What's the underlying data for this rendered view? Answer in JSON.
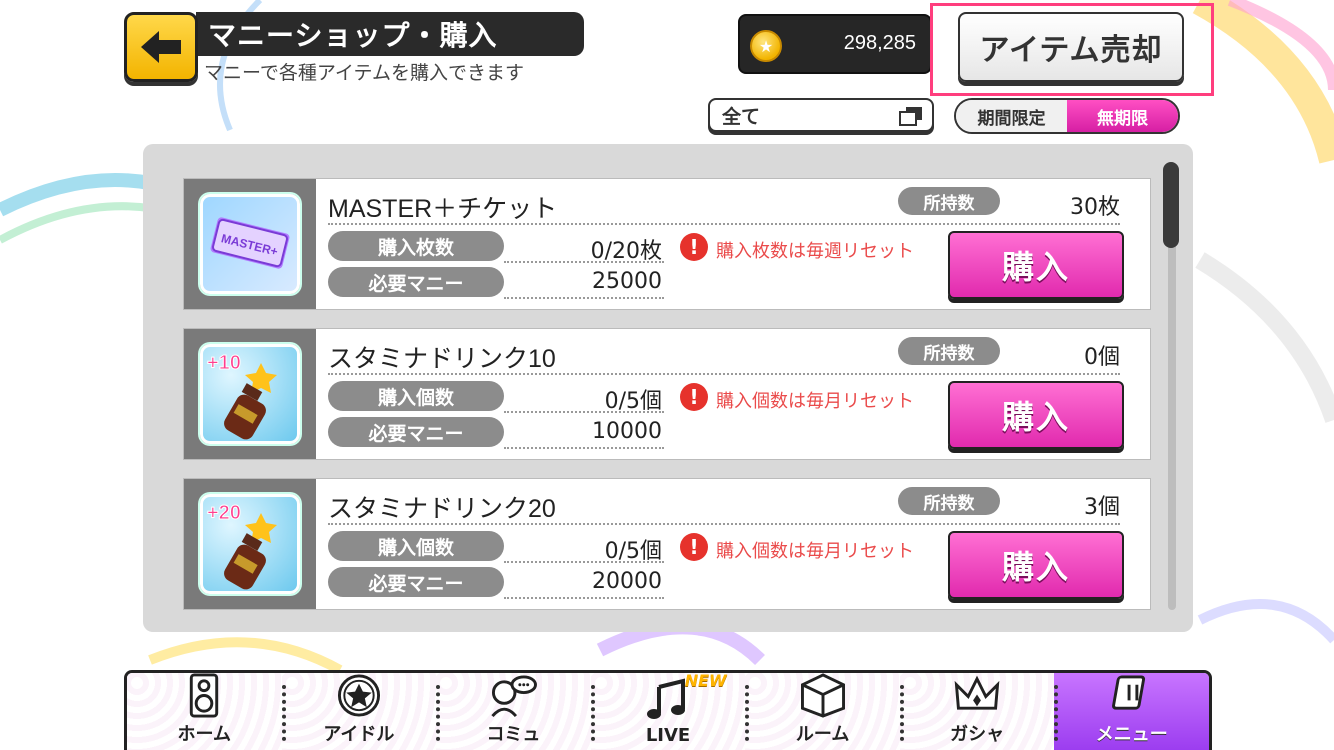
{
  "header": {
    "title": "マニーショップ・購入",
    "subtitle": "マニーで各種アイテムを購入できます",
    "money": "298,285",
    "sell_button": "アイテム売却"
  },
  "filters": {
    "category_selected": "全て",
    "period_options": [
      "期間限定",
      "無期限"
    ],
    "period_selected": "無期限"
  },
  "items": [
    {
      "name": "MASTER＋チケット",
      "owned_label": "所持数",
      "owned_value": "30枚",
      "count_label": "購入枚数",
      "count_value": "0/20枚",
      "cost_label": "必要マニー",
      "cost_value": "25000",
      "notice": "購入枚数は毎週リセット",
      "buy_label": "購入",
      "thumb_text": "MASTER+"
    },
    {
      "name": "スタミナドリンク10",
      "owned_label": "所持数",
      "owned_value": "0個",
      "count_label": "購入個数",
      "count_value": "0/5個",
      "cost_label": "必要マニー",
      "cost_value": "10000",
      "notice": "購入個数は毎月リセット",
      "buy_label": "購入",
      "thumb_text": "+10"
    },
    {
      "name": "スタミナドリンク20",
      "owned_label": "所持数",
      "owned_value": "3個",
      "count_label": "購入個数",
      "count_value": "0/5個",
      "cost_label": "必要マニー",
      "cost_value": "20000",
      "notice": "購入個数は毎月リセット",
      "buy_label": "購入",
      "thumb_text": "+20"
    }
  ],
  "nav": {
    "items": [
      {
        "label": "ホーム",
        "icon": "speaker-icon"
      },
      {
        "label": "アイドル",
        "icon": "star-icon"
      },
      {
        "label": "コミュ",
        "icon": "chat-icon"
      },
      {
        "label": "LIVE",
        "icon": "music-note-icon",
        "badge": "NEW"
      },
      {
        "label": "ルーム",
        "icon": "room-icon"
      },
      {
        "label": "ガシャ",
        "icon": "crown-icon"
      },
      {
        "label": "メニュー",
        "icon": "menu-icon"
      }
    ],
    "active": "メニュー"
  },
  "colors": {
    "accent_pink": "#e12aae",
    "highlight": "#ff3e7e",
    "warning": "#ea4b4b",
    "back_yellow": "#f3b400"
  }
}
